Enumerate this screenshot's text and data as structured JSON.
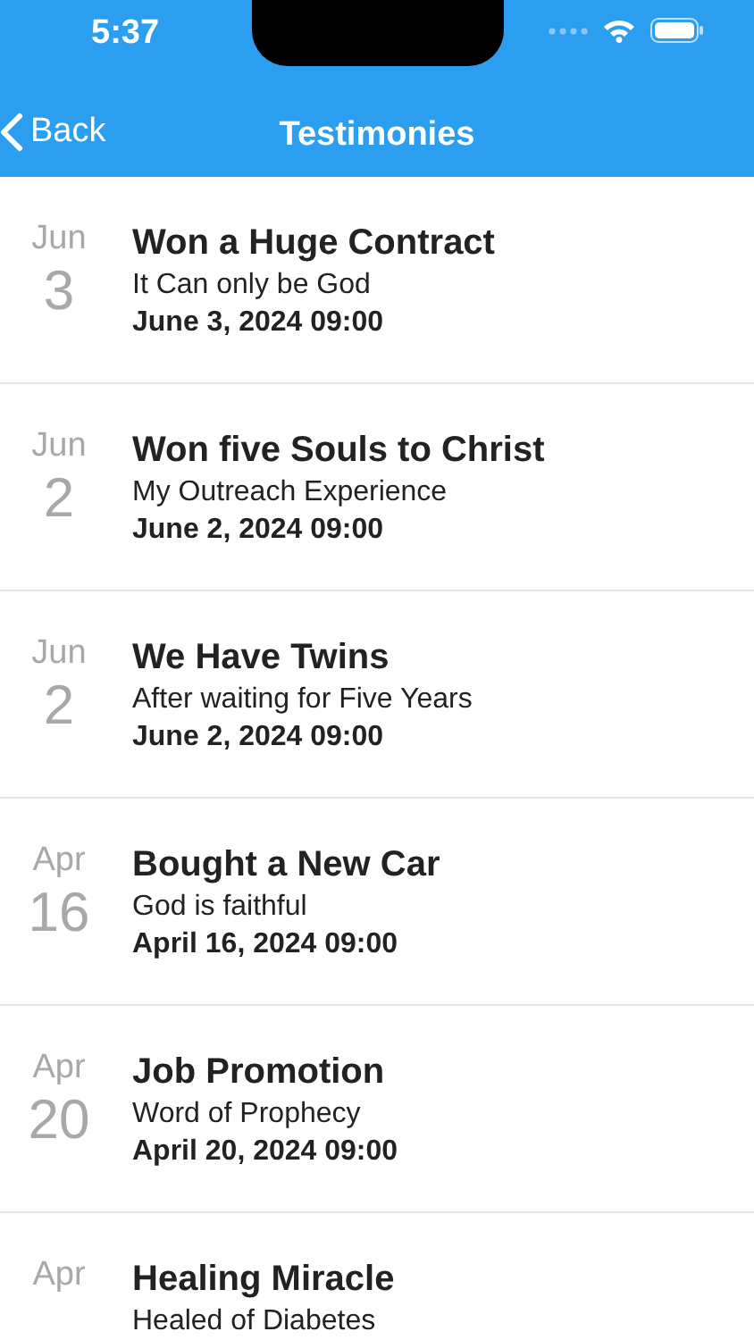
{
  "status_bar": {
    "time": "5:37"
  },
  "nav": {
    "back": "Back",
    "title": "Testimonies"
  },
  "testimonies": [
    {
      "month": "Jun",
      "day": "3",
      "title": "Won a Huge Contract",
      "subtitle": "It Can only be God",
      "date": "June 3, 2024 09:00"
    },
    {
      "month": "Jun",
      "day": "2",
      "title": "Won five Souls to Christ",
      "subtitle": "My Outreach Experience",
      "date": "June 2, 2024 09:00"
    },
    {
      "month": "Jun",
      "day": "2",
      "title": "We Have Twins",
      "subtitle": "After waiting for Five Years",
      "date": "June 2, 2024 09:00"
    },
    {
      "month": "Apr",
      "day": "16",
      "title": "Bought a New Car",
      "subtitle": "God is faithful",
      "date": "April 16, 2024 09:00"
    },
    {
      "month": "Apr",
      "day": "20",
      "title": "Job Promotion",
      "subtitle": "Word of Prophecy",
      "date": "April 20, 2024 09:00"
    },
    {
      "month": "Apr",
      "title": "Healing Miracle",
      "subtitle": "Healed of Diabetes"
    }
  ]
}
